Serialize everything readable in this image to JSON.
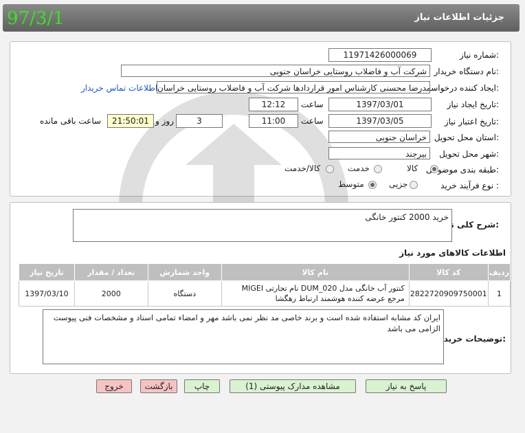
{
  "header": {
    "title": "جزئیات اطلاعات نیاز",
    "date_stamp": "97/3/1"
  },
  "form": {
    "need_number_label": "شماره نیاز:",
    "need_number": "11971426000069",
    "buyer_org_label": "نام دستگاه خریدار:",
    "buyer_org": "شرکت آب و فاضلاب روستایی خراسان جنوبی",
    "creator_label": "ایجاد کننده درخواست:",
    "creator": "محمدرضا محسنی کارشناس امور قراردادها شرکت آب و فاضلاب روستایی خراسان",
    "contact_link": "اطلاعات تماس خریدار",
    "created_date_label": "تاریخ ایجاد نیاز:",
    "created_date": "1397/03/01",
    "time_label": "ساعت",
    "created_time": "12:12",
    "validity_label": "تاریخ اعتبار نیاز:",
    "validity_date": "1397/03/05",
    "validity_time": "11:00",
    "days_value": "3",
    "days_label": "روز و",
    "remaining_time": "21:50:01",
    "remaining_label": "ساعت باقی مانده",
    "province_label": "استان محل تحویل:",
    "province": "خراسان جنوبی",
    "city_label": "شهر محل تحویل:",
    "city": "بیرجند",
    "category_label": "طبقه بندی موضوعی:",
    "category_options": [
      "کالا",
      "خدمت",
      "کالا/خدمت"
    ],
    "process_label": "نوع فرآیند خرید :",
    "process_options": [
      "جزیی",
      "متوسط"
    ]
  },
  "summary": {
    "label": "شرح کلی نیاز:",
    "text": "خرید 2000 کنتور خانگی"
  },
  "goods": {
    "title": "اطلاعات کالاهای مورد نیاز",
    "columns": [
      "ردیف",
      "کد کالا",
      "نام کالا",
      "واحد شمارش",
      "تعداد / مقدار",
      "تاریخ نیاز"
    ],
    "rows": [
      {
        "row": "1",
        "code": "2822720909750001",
        "name": "کنتور آب خانگی مدل DUM_020 نام تجارتی MIGEI مرجع عرضه کننده هوشمند ارتباط رهگشا",
        "unit": "دستگاه",
        "qty": "2000",
        "date": "1397/03/10"
      }
    ]
  },
  "buyer_notes": {
    "label": "توضیحات خریدار:",
    "text": "ایران کد مشابه استفاده شده است و برند خاصی مد نظر نمی باشد مهر و امضاء تمامی اسناد و مشخصات فنی پیوست الزامی می باشد"
  },
  "buttons": {
    "reply": "پاسخ به نیاز",
    "attachments": "مشاهده مدارک پیوستی (1)",
    "print": "چاپ",
    "back": "بازگشت",
    "exit": "خروج"
  }
}
